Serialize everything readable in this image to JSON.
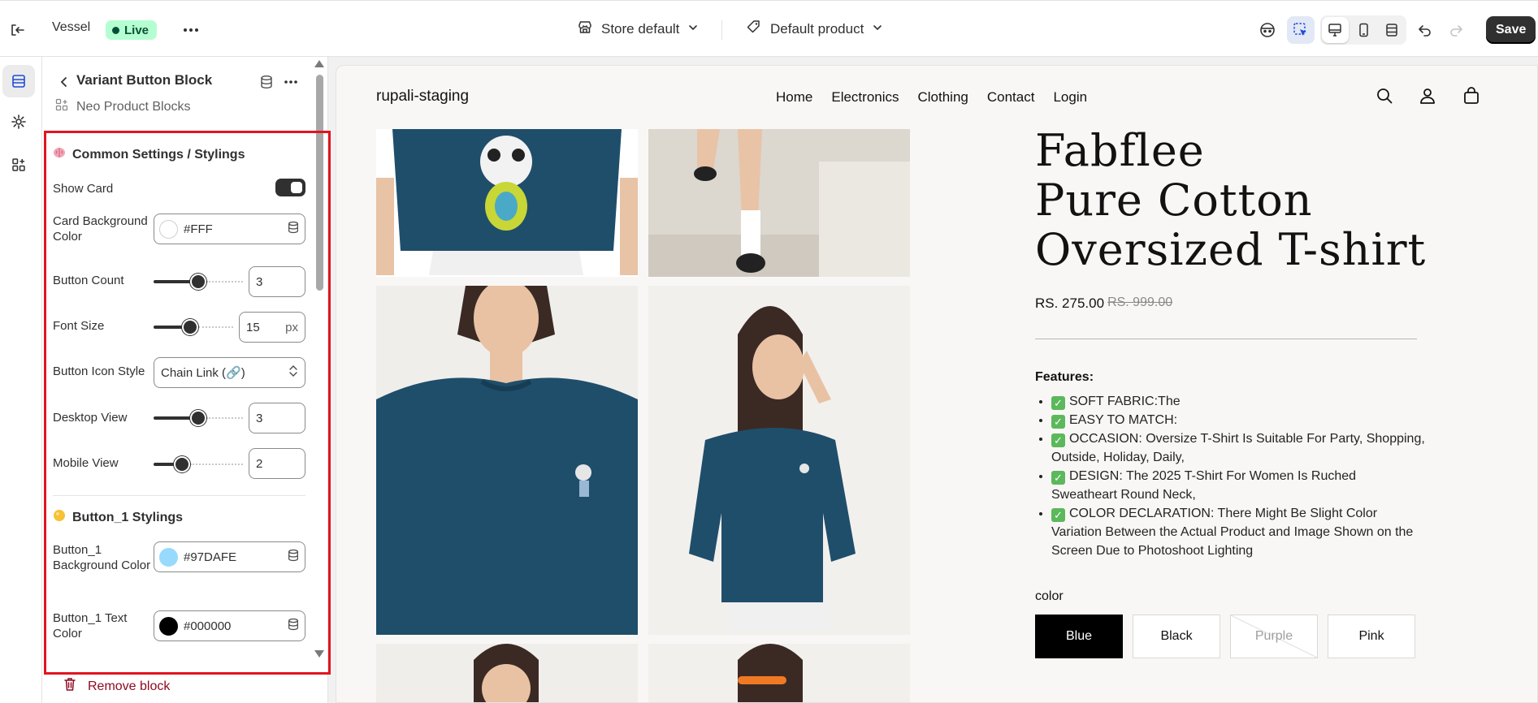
{
  "topbar": {
    "app_name": "Vessel",
    "status_badge": "Live",
    "store_selector": "Store default",
    "product_selector": "Default product",
    "save_label": "Save"
  },
  "panel": {
    "block_title": "Variant Button Block",
    "block_subtitle": "Neo Product Blocks",
    "remove_label": "Remove block",
    "common_section": {
      "title": "Common Settings / Stylings",
      "show_card_label": "Show Card",
      "show_card_on": true,
      "card_bg_label": "Card Background Color",
      "card_bg_value": "#FFF",
      "button_count_label": "Button Count",
      "button_count_value": "3",
      "button_count_fraction": 0.5,
      "font_size_label": "Font Size",
      "font_size_value": "15",
      "font_size_unit": "px",
      "font_size_fraction": 0.45,
      "icon_style_label": "Button Icon Style",
      "icon_style_value": "Chain Link (🔗)",
      "desktop_view_label": "Desktop View",
      "desktop_view_value": "3",
      "desktop_view_fraction": 0.5,
      "mobile_view_label": "Mobile View",
      "mobile_view_value": "2",
      "mobile_view_fraction": 0.28
    },
    "button1_section": {
      "title": "Button_1 Stylings",
      "bg_label": "Button_1 Background Color",
      "bg_value": "#97DAFE",
      "text_color_label": "Button_1 Text Color",
      "text_color_value": "#000000"
    }
  },
  "preview": {
    "store_name": "rupali-staging",
    "nav": [
      "Home",
      "Electronics",
      "Clothing",
      "Contact",
      "Login"
    ],
    "product_title": [
      "Fabflee",
      "Pure Cotton",
      "Oversized T-shirt"
    ],
    "price": "RS. 275.00",
    "compare_price": "RS. 999.00",
    "features_title": "Features:",
    "features": [
      "SOFT FABRIC:The",
      "EASY TO MATCH:",
      "OCCASION: Oversize T-Shirt Is Suitable For Party, Shopping, Outside, Holiday, Daily,",
      "DESIGN: The 2025 T-Shirt For Women Is Ruched Sweatheart Round Neck,",
      "COLOR DECLARATION: There Might Be Slight Color Variation Between the Actual Product and Image Shown on the Screen Due to Photoshoot Lighting"
    ],
    "color_label": "color",
    "variants": [
      {
        "label": "Blue",
        "state": "selected"
      },
      {
        "label": "Black",
        "state": "normal"
      },
      {
        "label": "Purple",
        "state": "disabled"
      },
      {
        "label": "Pink",
        "state": "normal"
      }
    ]
  },
  "colors": {
    "card_bg_swatch": "#FFFFFF",
    "button1_bg_swatch": "#97DAFE",
    "button1_text_swatch": "#000000",
    "shirt": "#1f4e6b",
    "highlight": "#e3141f"
  }
}
